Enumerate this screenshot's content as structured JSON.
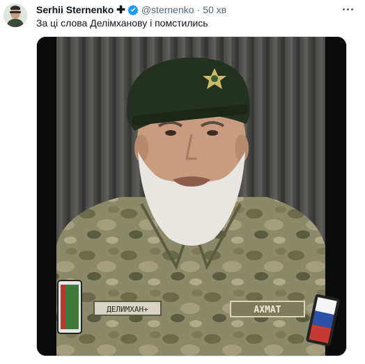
{
  "tweet": {
    "author_name": "Serhii Sternenko",
    "cross_glyph": "✚",
    "handle": "@sternenko",
    "separator": "·",
    "time": "50 хв",
    "text": "За ці слова Делімханову і помстились",
    "media": {
      "icons": [
        "avatar",
        "verified-badge",
        "more-icon"
      ],
      "name_patch": "ДЕЛИМХАН+",
      "unit_patch": "AXMAT"
    }
  },
  "colors": {
    "text_primary": "#0f1419",
    "text_secondary": "#536471",
    "verified": "#1d9bf0",
    "media_border": "#cfd9de"
  }
}
